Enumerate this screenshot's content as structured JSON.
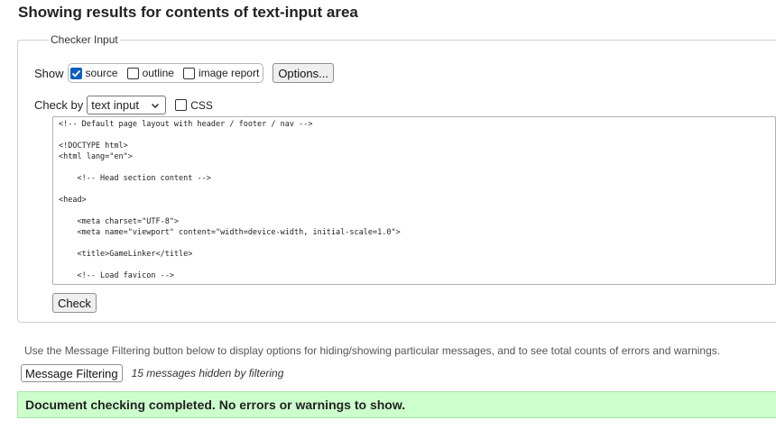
{
  "heading": "Showing results for contents of text-input area",
  "checker": {
    "legend": "Checker Input",
    "show_label": "Show",
    "show_options": [
      {
        "label": "source",
        "checked": true
      },
      {
        "label": "outline",
        "checked": false
      },
      {
        "label": "image report",
        "checked": false
      }
    ],
    "options_button": "Options...",
    "check_by_label": "Check by",
    "check_by_select": "text input",
    "css_label": "CSS",
    "css_checked": false,
    "source_text": "<!-- Default page layout with header / footer / nav -->\n\n<!DOCTYPE html>\n<html lang=\"en\">\n\n    <!-- Head section content -->\n\n<head>\n\n    <meta charset=\"UTF-8\">\n    <meta name=\"viewport\" content=\"width=device-width, initial-scale=1.0\">\n\n    <title>GameLinker</title>\n\n    <!-- Load favicon -->",
    "check_button": "Check"
  },
  "filtering": {
    "hint": "Use the Message Filtering button below to display options for hiding/showing particular messages, and to see total counts of errors and warnings.",
    "button": "Message Filtering",
    "hidden_note": "15 messages hidden by filtering"
  },
  "result": {
    "message": "Document checking completed. No errors or warnings to show.",
    "color": "#ccffcc"
  },
  "colors": {
    "checkbox_accent": "#0b5fbf"
  }
}
